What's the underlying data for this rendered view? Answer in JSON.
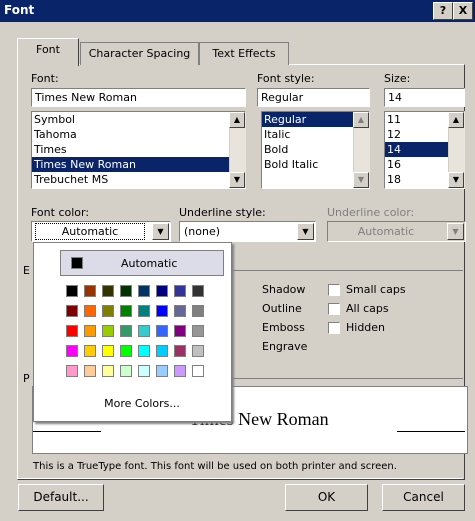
{
  "window": {
    "title": "Font",
    "help": "?",
    "close": "X"
  },
  "tabs": [
    {
      "label": "Font"
    },
    {
      "label": "Character Spacing"
    },
    {
      "label": "Text Effects"
    }
  ],
  "font": {
    "label": "Font:",
    "value": "Times New Roman",
    "items": [
      "Symbol",
      "Tahoma",
      "Times",
      "Times New Roman",
      "Trebuchet MS"
    ],
    "selected": "Times New Roman"
  },
  "style": {
    "label": "Font style:",
    "value": "Regular",
    "items": [
      "Regular",
      "Italic",
      "Bold",
      "Bold Italic"
    ],
    "selected": "Regular"
  },
  "size": {
    "label": "Size:",
    "value": "14",
    "items": [
      "11",
      "12",
      "14",
      "16",
      "18"
    ],
    "selected": "14"
  },
  "font_color": {
    "label": "Font color:",
    "value": "Automatic"
  },
  "underline_style": {
    "label": "Underline style:",
    "value": "(none)"
  },
  "underline_color": {
    "label": "Underline color:",
    "value": "Automatic"
  },
  "effects": {
    "section_initial": "E",
    "shadow": "Shadow",
    "outline": "Outline",
    "emboss": "Emboss",
    "engrave": "Engrave",
    "small_caps": "Small caps",
    "all_caps": "All caps",
    "hidden": "Hidden"
  },
  "preview_initial": "P",
  "color_popup": {
    "automatic_label": "Automatic",
    "more_colors": "More Colors...",
    "rows": [
      [
        "#000000",
        "#993300",
        "#333300",
        "#003300",
        "#003366",
        "#000080",
        "#333399",
        "#333333"
      ],
      [
        "#800000",
        "#ff6600",
        "#808000",
        "#008000",
        "#008080",
        "#0000ff",
        "#666699",
        "#808080"
      ],
      [
        "#ff0000",
        "#ff9900",
        "#99cc00",
        "#339966",
        "#33cccc",
        "#3366ff",
        "#800080",
        "#969696"
      ],
      [
        "#ff00ff",
        "#ffcc00",
        "#ffff00",
        "#00ff00",
        "#00ffff",
        "#00ccff",
        "#993366",
        "#c0c0c0"
      ],
      [
        "#ff99cc",
        "#ffcc99",
        "#ffff99",
        "#ccffcc",
        "#ccffff",
        "#99ccff",
        "#cc99ff",
        "#ffffff"
      ]
    ]
  },
  "preview": {
    "text": "Times New Roman"
  },
  "footnote": "This is a TrueType font. This font will be used on both printer and screen.",
  "buttons": {
    "default": "Default...",
    "ok": "OK",
    "cancel": "Cancel"
  }
}
